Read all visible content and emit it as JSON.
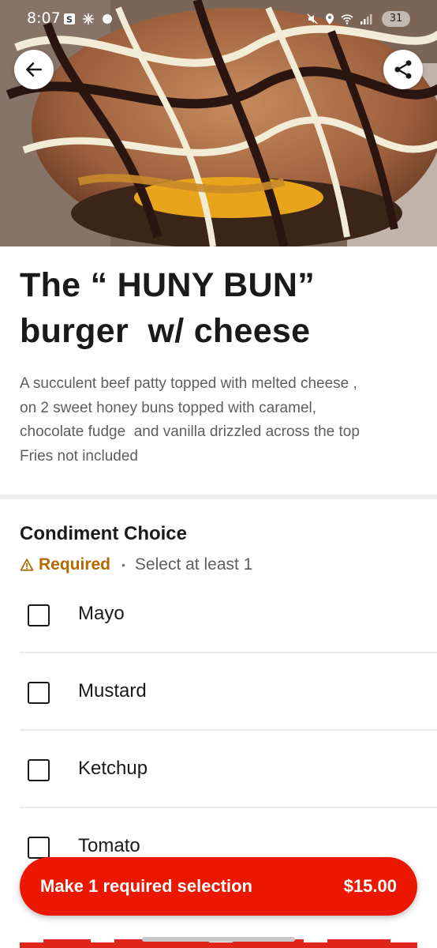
{
  "status_bar": {
    "time": "8:07",
    "battery": "31"
  },
  "hero": {
    "back_icon": "arrow-left-icon",
    "share_icon": "share-icon"
  },
  "item": {
    "title": "The “ HUNY BUN”\nburger  w/ cheese",
    "description": "A succulent beef patty topped with melted cheese ,\non 2 sweet honey buns topped with caramel,\nchocolate fudge  and vanilla drizzled across the top\nFries not included"
  },
  "condiment": {
    "title": "Condiment Choice",
    "required_label": "Required",
    "separator": "•",
    "hint": "Select at least 1",
    "options": [
      {
        "label": "Mayo"
      },
      {
        "label": "Mustard"
      },
      {
        "label": "Ketchup"
      },
      {
        "label": "Tomato"
      }
    ]
  },
  "cta": {
    "label": "Make 1 required selection",
    "price": "$15.00"
  },
  "colors": {
    "accent": "#eb1700",
    "required": "#b26a00"
  }
}
